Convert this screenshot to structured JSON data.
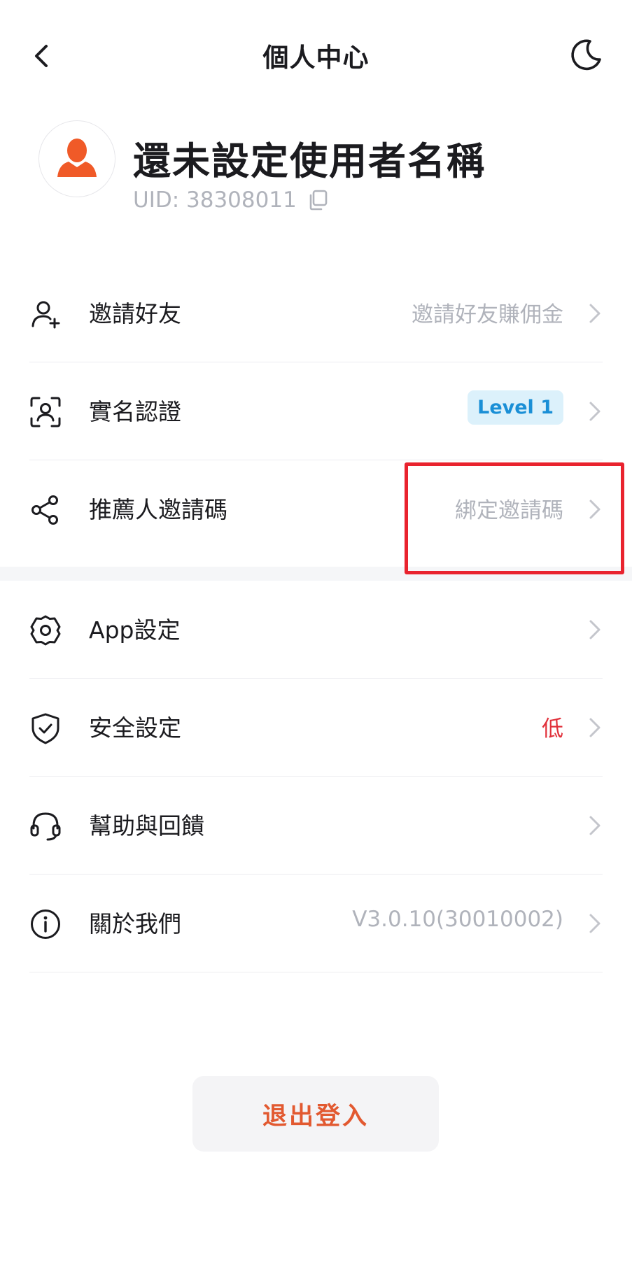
{
  "header": {
    "title": "個人中心",
    "back_icon": "chevron-left-icon",
    "theme_icon": "moon-icon"
  },
  "profile": {
    "username": "還未設定使用者名稱",
    "uid": "UID: 38308011",
    "avatar_color": "#f05a28"
  },
  "menu_group_1": [
    {
      "icon": "add-user-icon",
      "label": "邀請好友",
      "value": "邀請好友賺佣金"
    },
    {
      "icon": "face-id-icon",
      "label": "實名認證",
      "badge": "Level 1"
    },
    {
      "icon": "share-icon",
      "label": "推薦人邀請碼",
      "value": "綁定邀請碼"
    }
  ],
  "menu_group_2": [
    {
      "icon": "gear-icon",
      "label": "App設定",
      "value": ""
    },
    {
      "icon": "shield-check-icon",
      "label": "安全設定",
      "value": "低",
      "value_color": "#e1303a"
    },
    {
      "icon": "headset-icon",
      "label": "幫助與回饋",
      "value": ""
    },
    {
      "icon": "info-icon",
      "label": "關於我們",
      "value": "V3.0.10(30010002)"
    }
  ],
  "logout": {
    "label": "退出登入"
  },
  "colors": {
    "accent": "#e25930",
    "badge_bg": "#dcf1fb",
    "badge_text": "#1a8fd6",
    "highlight": "#e9232e"
  }
}
